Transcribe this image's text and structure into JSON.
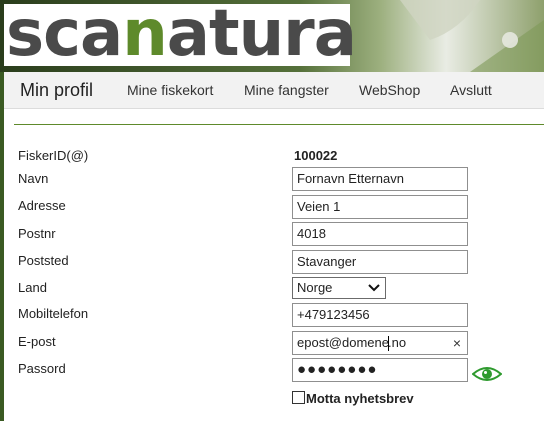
{
  "header": {
    "logo": {
      "part1": "sca",
      "part2": "n",
      "part3": "atura"
    }
  },
  "nav": {
    "items": [
      {
        "label": "Min profil"
      },
      {
        "label": "Mine fiskekort"
      },
      {
        "label": "Mine fangster"
      },
      {
        "label": "WebShop"
      },
      {
        "label": "Avslutt"
      }
    ]
  },
  "profile": {
    "fisker_id": {
      "label": "FiskerID(@)",
      "value": "100022"
    },
    "navn": {
      "label": "Navn",
      "value": "Fornavn Etternavn"
    },
    "adresse": {
      "label": "Adresse",
      "value": "Veien 1"
    },
    "postnr": {
      "label": "Postnr",
      "value": "4018"
    },
    "poststed": {
      "label": "Poststed",
      "value": "Stavanger"
    },
    "land": {
      "label": "Land",
      "value": "Norge"
    },
    "mobiltelefon": {
      "label": "Mobiltelefon",
      "value": "+479123456"
    },
    "epost": {
      "label": "E-post",
      "value_before_caret": "epost@domene",
      "value_after_caret": ".no",
      "clear_symbol": "×"
    },
    "passord": {
      "label": "Passord",
      "masked_value": "●●●●●●●●"
    },
    "newsletter": {
      "label": "Motta nyhetsbrev",
      "checked": false
    }
  },
  "icons": {
    "eye": "eye-icon",
    "select_arrow": "chevron-down-icon",
    "clear": "close-icon"
  },
  "colors": {
    "brand_green": "#5e8a2b",
    "brand_dark": "#4a4a4a",
    "eye_green": "#2e9a2e"
  }
}
